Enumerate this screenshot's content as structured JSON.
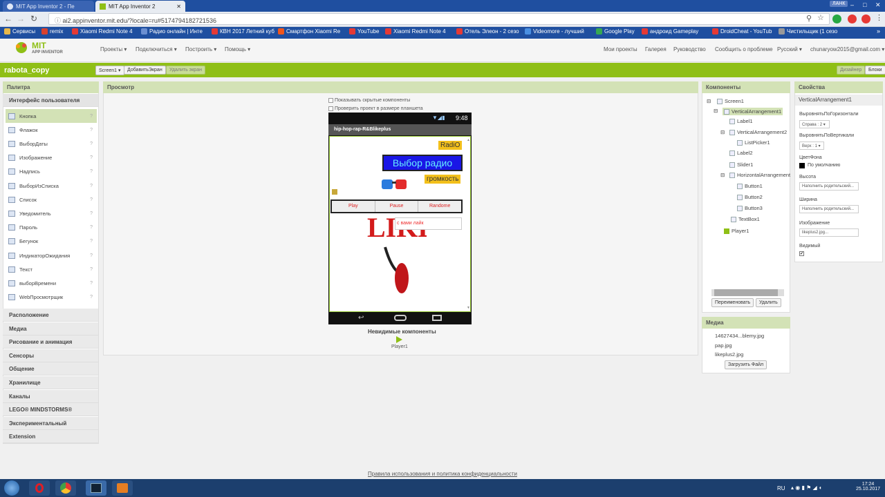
{
  "browser": {
    "tabs": [
      {
        "label": "MIT App Inventor 2 - Пе"
      },
      {
        "label": "MIT App Inventor 2"
      }
    ],
    "user_badge": "ЛАНК",
    "url": "ai2.appinventor.mit.edu/?locale=ru#5174794182721536",
    "bookmarks": [
      {
        "label": "Сервисы",
        "color": "#e8b84a"
      },
      {
        "label": "remix",
        "color": "#d9412e"
      },
      {
        "label": "Xiaomi Redmi Note 4",
        "color": "#e53935"
      },
      {
        "label": "Радио онлайн | Инте",
        "color": "#6b8fd1"
      },
      {
        "label": "КВН 2017 Летний куб",
        "color": "#e53935"
      },
      {
        "label": "Смартфон Xiaomi Re",
        "color": "#f0561c"
      },
      {
        "label": "YouTube",
        "color": "#e53935"
      },
      {
        "label": "Xiaomi Redmi Note 4",
        "color": "#e53935"
      },
      {
        "label": "Отель Элеон - 2 сезо",
        "color": "#e53935"
      },
      {
        "label": "Videomore - лучший",
        "color": "#4a90e2"
      },
      {
        "label": "Google Play",
        "color": "#36a852"
      },
      {
        "label": "андроид Gameplay",
        "color": "#e53935"
      },
      {
        "label": "DroidCheat - YouTub",
        "color": "#e53935"
      },
      {
        "label": "Чистильщик (1 сезо",
        "color": "#999999"
      }
    ]
  },
  "app": {
    "logo_top": "MIT",
    "logo_bottom": "APP INVENTOR",
    "menus": [
      "Проекты ▾",
      "Подключиться ▾",
      "Построить ▾",
      "Помощь ▾"
    ],
    "right_menus": [
      "Мои проекты",
      "Галерея",
      "Руководство",
      "Сообщить о проблеме",
      "Русский ▾",
      "chunaryow2015@gmail.com ▾"
    ],
    "project_name": "rabota_copy",
    "screen_select": "Screen1 ▾",
    "add_screen": "ДобавитьЭкран",
    "remove_screen": "Удалить экран",
    "designer_btn": "Дизайнер",
    "blocks_btn": "Блоки"
  },
  "palette": {
    "title": "Палитра",
    "user_interface": "Интерфейс пользователя",
    "items": [
      "Кнопка",
      "Флажок",
      "ВыборДаты",
      "Изображение",
      "Надпись",
      "ВыборИзСписка",
      "Список",
      "Уведомитель",
      "Пароль",
      "Бегунок",
      "ИндикаторОжидания",
      "Текст",
      "выборВремени",
      "WebПросмотрщик"
    ],
    "categories": [
      "Расположение",
      "Медиа",
      "Рисование и анимация",
      "Сенсоры",
      "Общение",
      "Хранилище",
      "Каналы",
      "LEGO® MINDSTORMS®",
      "Экспериментальный",
      "Extension"
    ]
  },
  "viewer": {
    "title": "Просмотр",
    "show_hidden": "Показывать скрытые компоненты",
    "tablet_check": "Проверить проект в размере планшета",
    "time": "9:48",
    "screen_title": "hip-hop-rap-R&Blikeplus",
    "radio_label": "RadiO",
    "choose_radio": "Выбор радио",
    "volume": "громкость",
    "buttons": [
      "Play",
      "Pause",
      "Randome"
    ],
    "textbox": "с вами лайк",
    "nonvisible_title": "Невидимые компоненты",
    "player": "Player1"
  },
  "components": {
    "title": "Компоненты",
    "tree": [
      "Screen1",
      "VerticalArrangement1",
      "Label1",
      "VerticalArrangement2",
      "ListPicker1",
      "Label2",
      "Slider1",
      "HorizontalArrangement",
      "Button1",
      "Button2",
      "Button3",
      "TextBox1",
      "Player1"
    ],
    "rename": "Переименовать",
    "delete": "Удалить"
  },
  "media": {
    "title": "Медиа",
    "files": [
      "14627434...blemy.jpg",
      "pap.jpg",
      "likeplus2.jpg"
    ],
    "upload": "Загрузить Файл"
  },
  "properties": {
    "title": "Свойства",
    "component": "VerticalArrangement1",
    "align_h_label": "ВыровнятьПоГоризонтали",
    "align_h_value": "Справа : 2 ▾",
    "align_v_label": "ВыровнятьПоВертикали",
    "align_v_value": "Верх : 1 ▾",
    "bg_label": "ЦветФона",
    "bg_value": "По умолчанию",
    "height_label": "Высота",
    "height_value": "Наполнить родительский...",
    "width_label": "Ширина",
    "width_value": "Наполнить родительский...",
    "image_label": "Изображение",
    "image_value": "likeplus2.jpg...",
    "visible_label": "Видимый"
  },
  "footer": "Правила использования и политика конфиденциальности",
  "taskbar": {
    "lang": "RU",
    "time": "17:24",
    "date": "25.10.2017"
  }
}
